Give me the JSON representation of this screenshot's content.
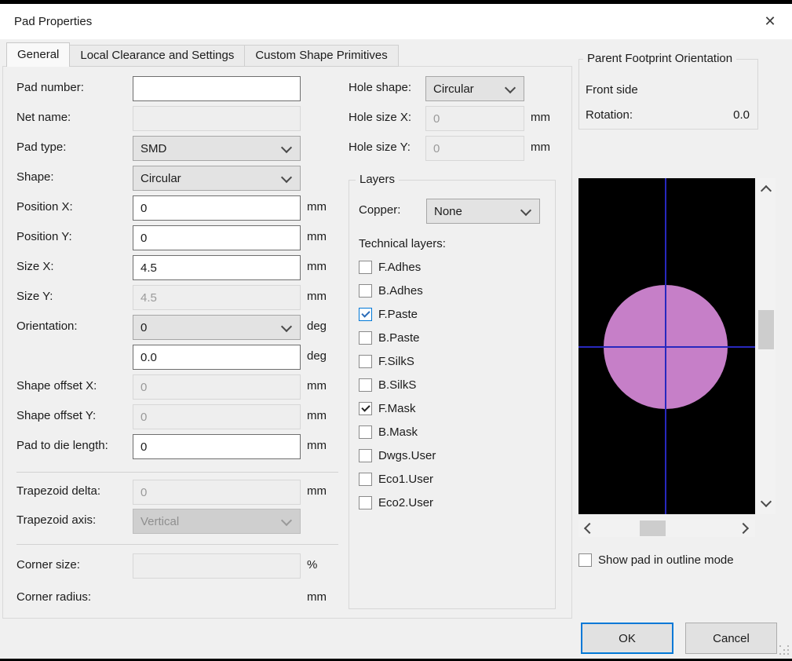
{
  "window": {
    "title": "Pad Properties",
    "close_icon": "✕"
  },
  "tabs": [
    {
      "label": "General",
      "active": true
    },
    {
      "label": "Local Clearance and Settings",
      "active": false
    },
    {
      "label": "Custom Shape Primitives",
      "active": false
    }
  ],
  "general": {
    "pad_number": {
      "label": "Pad number:",
      "value": ""
    },
    "net_name": {
      "label": "Net name:",
      "value": ""
    },
    "pad_type": {
      "label": "Pad type:",
      "value": "SMD"
    },
    "shape": {
      "label": "Shape:",
      "value": "Circular"
    },
    "position_x": {
      "label": "Position X:",
      "value": "0",
      "unit": "mm"
    },
    "position_y": {
      "label": "Position Y:",
      "value": "0",
      "unit": "mm"
    },
    "size_x": {
      "label": "Size X:",
      "value": "4.5",
      "unit": "mm"
    },
    "size_y": {
      "label": "Size Y:",
      "value": "4.5",
      "unit": "mm"
    },
    "orientation": {
      "label": "Orientation:",
      "value": "0",
      "unit": "deg"
    },
    "orientation_custom": {
      "value": "0.0",
      "unit": "deg"
    },
    "shape_offset_x": {
      "label": "Shape offset X:",
      "value": "0",
      "unit": "mm"
    },
    "shape_offset_y": {
      "label": "Shape offset Y:",
      "value": "0",
      "unit": "mm"
    },
    "pad_to_die": {
      "label": "Pad to die length:",
      "value": "0",
      "unit": "mm"
    },
    "trapezoid_delta": {
      "label": "Trapezoid delta:",
      "value": "0",
      "unit": "mm"
    },
    "trapezoid_axis": {
      "label": "Trapezoid axis:",
      "value": "Vertical"
    },
    "corner_size": {
      "label": "Corner size:",
      "value": "",
      "unit": "%"
    },
    "corner_radius": {
      "label": "Corner radius:",
      "unit": "mm"
    },
    "hole_shape": {
      "label": "Hole shape:",
      "value": "Circular"
    },
    "hole_size_x": {
      "label": "Hole size X:",
      "value": "0",
      "unit": "mm"
    },
    "hole_size_y": {
      "label": "Hole size Y:",
      "value": "0",
      "unit": "mm"
    }
  },
  "layers": {
    "title": "Layers",
    "copper": {
      "label": "Copper:",
      "value": "None"
    },
    "technical_label": "Technical layers:",
    "technical": [
      {
        "label": "F.Adhes",
        "checked": false,
        "focused": false
      },
      {
        "label": "B.Adhes",
        "checked": false,
        "focused": false
      },
      {
        "label": "F.Paste",
        "checked": true,
        "focused": true
      },
      {
        "label": "B.Paste",
        "checked": false,
        "focused": false
      },
      {
        "label": "F.SilkS",
        "checked": false,
        "focused": false
      },
      {
        "label": "B.SilkS",
        "checked": false,
        "focused": false
      },
      {
        "label": "F.Mask",
        "checked": true,
        "focused": false
      },
      {
        "label": "B.Mask",
        "checked": false,
        "focused": false
      },
      {
        "label": "Dwgs.User",
        "checked": false,
        "focused": false
      },
      {
        "label": "Eco1.User",
        "checked": false,
        "focused": false
      },
      {
        "label": "Eco2.User",
        "checked": false,
        "focused": false
      }
    ]
  },
  "parent_orientation": {
    "title": "Parent Footprint Orientation",
    "side": "Front side",
    "rotation_label": "Rotation:",
    "rotation_value": "0.0"
  },
  "preview": {
    "outline_checkbox": {
      "label": "Show pad in outline mode",
      "checked": false
    },
    "colors": {
      "canvas": "#000000",
      "crosshair": "#2828be",
      "pad": "#c67fc8"
    }
  },
  "actions": {
    "ok": "OK",
    "cancel": "Cancel"
  },
  "colors": {
    "accent": "#0078d7",
    "window_bg": "#f0f0f0",
    "titlebar_bg": "#ffffff"
  }
}
